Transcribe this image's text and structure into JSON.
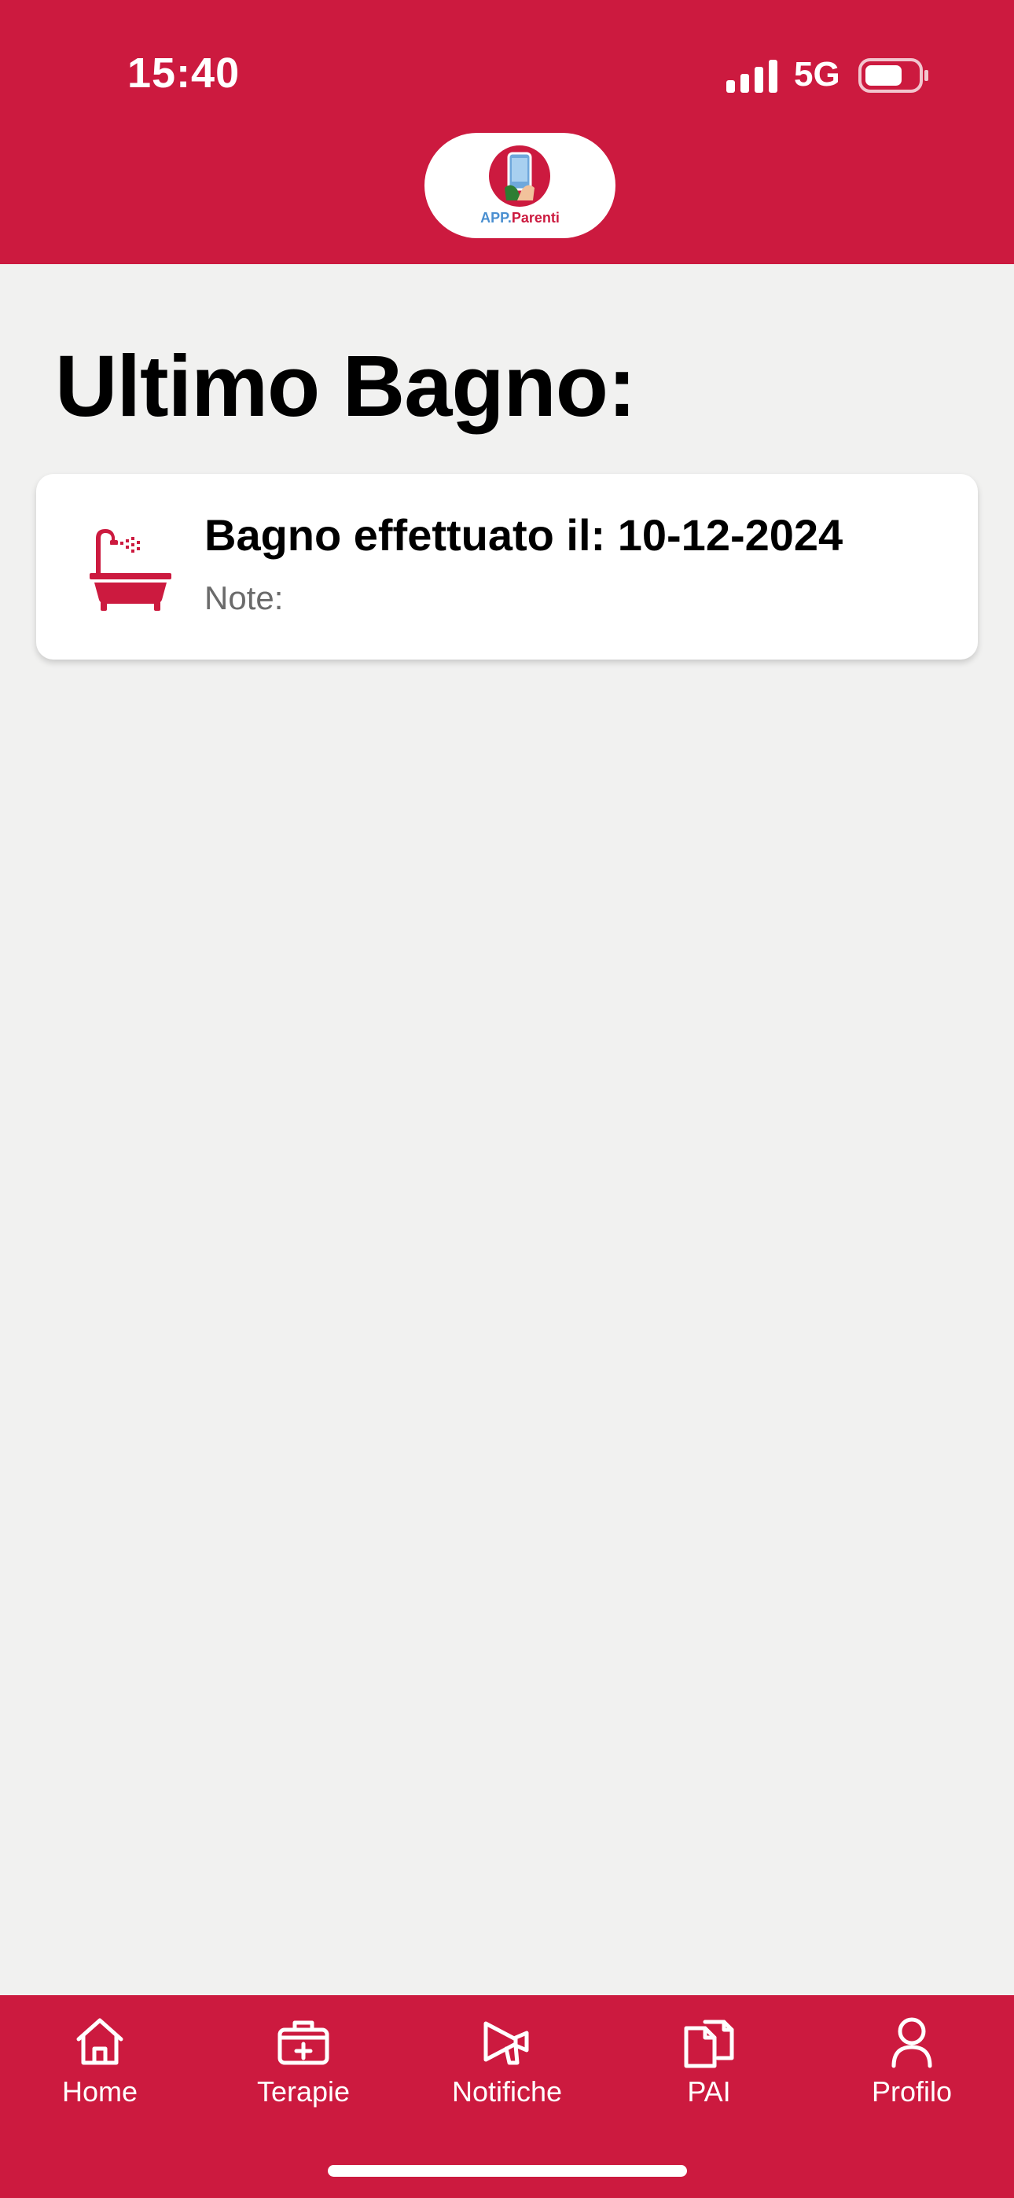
{
  "status_bar": {
    "time": "15:40",
    "network": "5G",
    "icons": [
      "signal-icon",
      "battery-icon"
    ]
  },
  "header": {
    "brand_color": "#cc1a3f",
    "logo": {
      "text_prefix": "APP.",
      "text_suffix": "Parenti"
    }
  },
  "main": {
    "title": "Ultimo Bagno:",
    "cards": [
      {
        "icon": "bathtub-icon",
        "title": "Bagno effettuato il: 10-12-2024",
        "note": "Note:"
      }
    ]
  },
  "tabbar": {
    "items": [
      {
        "label": "Home",
        "icon": "home-icon"
      },
      {
        "label": "Terapie",
        "icon": "medical-kit-icon"
      },
      {
        "label": "Notifiche",
        "icon": "megaphone-icon"
      },
      {
        "label": "PAI",
        "icon": "documents-icon"
      },
      {
        "label": "Profilo",
        "icon": "profile-icon"
      }
    ]
  }
}
